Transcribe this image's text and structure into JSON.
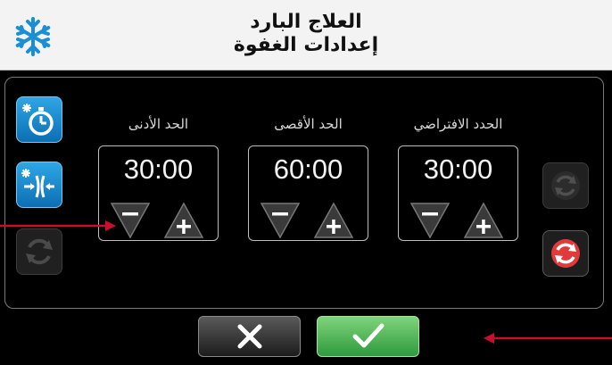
{
  "header": {
    "title_line1": "العلاج البارد",
    "title_line2": "إعدادات الغفوة",
    "icon": "snowflake-icon"
  },
  "sidebar": {
    "buttons": [
      {
        "name": "snooze-timer-button",
        "icon": "snowflake-stopwatch-icon",
        "state": "active"
      },
      {
        "name": "snooze-compress-button",
        "icon": "snowflake-compress-icon",
        "state": "active"
      },
      {
        "name": "snooze-reset-button",
        "icon": "refresh-icon",
        "state": "disabled"
      }
    ]
  },
  "groups": [
    {
      "label": "الحد الأدنى",
      "value": "30:00"
    },
    {
      "label": "الحد الأقصى",
      "value": "60:00"
    },
    {
      "label": "الحدد الافتراضي",
      "value": "30:00"
    }
  ],
  "right_buttons": [
    {
      "name": "restore-defaults-button",
      "icon": "refresh-icon",
      "state": "disabled"
    },
    {
      "name": "reset-button",
      "icon": "refresh-icon",
      "state": "active",
      "color": "#e23a3a"
    }
  ],
  "colors": {
    "accent_blue": "#1a8fd6",
    "confirm_green": "#43b04a",
    "annotation_red": "#c8102e"
  }
}
